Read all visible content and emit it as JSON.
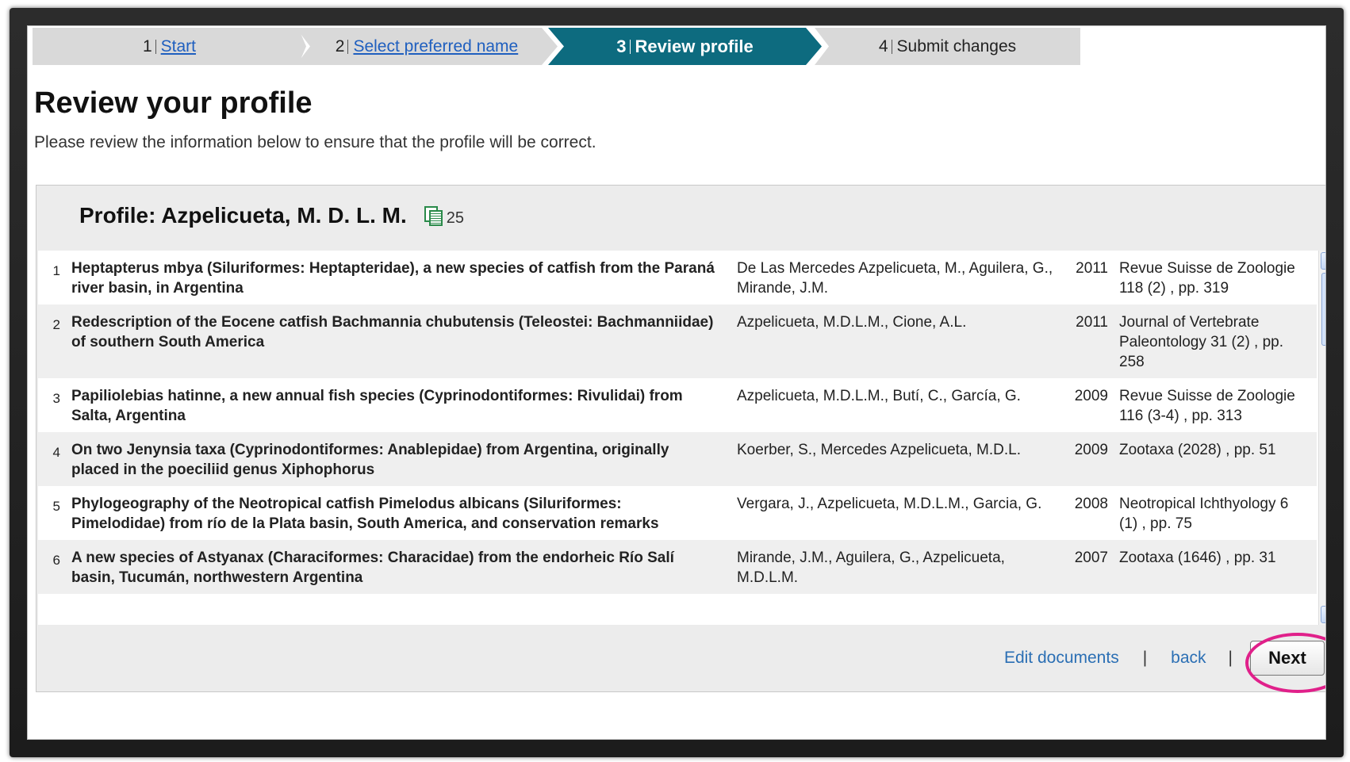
{
  "stepper": {
    "steps": [
      {
        "num": "1",
        "label": "Start"
      },
      {
        "num": "2",
        "label": "Select preferred name"
      },
      {
        "num": "3",
        "label": "Review profile"
      },
      {
        "num": "4",
        "label": "Submit changes"
      }
    ]
  },
  "page": {
    "title": "Review your profile",
    "description": "Please review the information below to ensure that the profile will be correct."
  },
  "profile": {
    "title": "Profile: Azpelicueta, M. D. L. M.",
    "doc_icon": "documents-icon",
    "doc_count": "25"
  },
  "documents": [
    {
      "idx": "1",
      "title": "Heptapterus mbya (Siluriformes: Heptapteridae), a new species of catfish from the Paraná river basin, in Argentina",
      "authors": "De Las Mercedes Azpelicueta, M., Aguilera, G., Mirande, J.M.",
      "year": "2011",
      "source": "Revue Suisse de Zoologie 118 (2) , pp. 319"
    },
    {
      "idx": "2",
      "title": "Redescription of the Eocene catfish Bachmannia chubutensis (Teleostei: Bachmanniidae) of southern South America",
      "authors": "Azpelicueta, M.D.L.M., Cione, A.L.",
      "year": "2011",
      "source": "Journal of Vertebrate Paleontology 31 (2) , pp. 258"
    },
    {
      "idx": "3",
      "title": "Papiliolebias hatinne, a new annual fish species (Cyprinodontiformes: Rivulidai) from Salta, Argentina",
      "authors": "Azpelicueta, M.D.L.M., Butí, C., García, G.",
      "year": "2009",
      "source": "Revue Suisse de Zoologie 116 (3-4) , pp. 313"
    },
    {
      "idx": "4",
      "title": "On two Jenynsia taxa (Cyprinodontiformes: Anablepidae) from Argentina, originally placed in the poeciliid genus Xiphophorus",
      "authors": "Koerber, S., Mercedes Azpelicueta, M.D.L.",
      "year": "2009",
      "source": "Zootaxa (2028) , pp. 51"
    },
    {
      "idx": "5",
      "title": "Phylogeography of the Neotropical catfish Pimelodus albicans (Siluriformes: Pimelodidae) from río de la Plata basin, South America, and conservation remarks",
      "authors": "Vergara, J., Azpelicueta, M.D.L.M., Garcia, G.",
      "year": "2008",
      "source": "Neotropical Ichthyology 6 (1) , pp. 75"
    },
    {
      "idx": "6",
      "title": "A new species of Astyanax (Characiformes: Characidae) from the endorheic Río Salí basin, Tucumán, northwestern Argentina",
      "authors": "Mirande, J.M., Aguilera, G., Azpelicueta, M.D.L.M.",
      "year": "2007",
      "source": "Zootaxa (1646) , pp. 31"
    }
  ],
  "footer": {
    "edit_label": "Edit documents",
    "separator": "|",
    "back_label": "back",
    "next_label": "Next"
  },
  "colors": {
    "active_step": "#0d6b7f",
    "inactive_step": "#d9d9d9",
    "link": "#2b6fb4",
    "highlight": "#e0208a"
  }
}
